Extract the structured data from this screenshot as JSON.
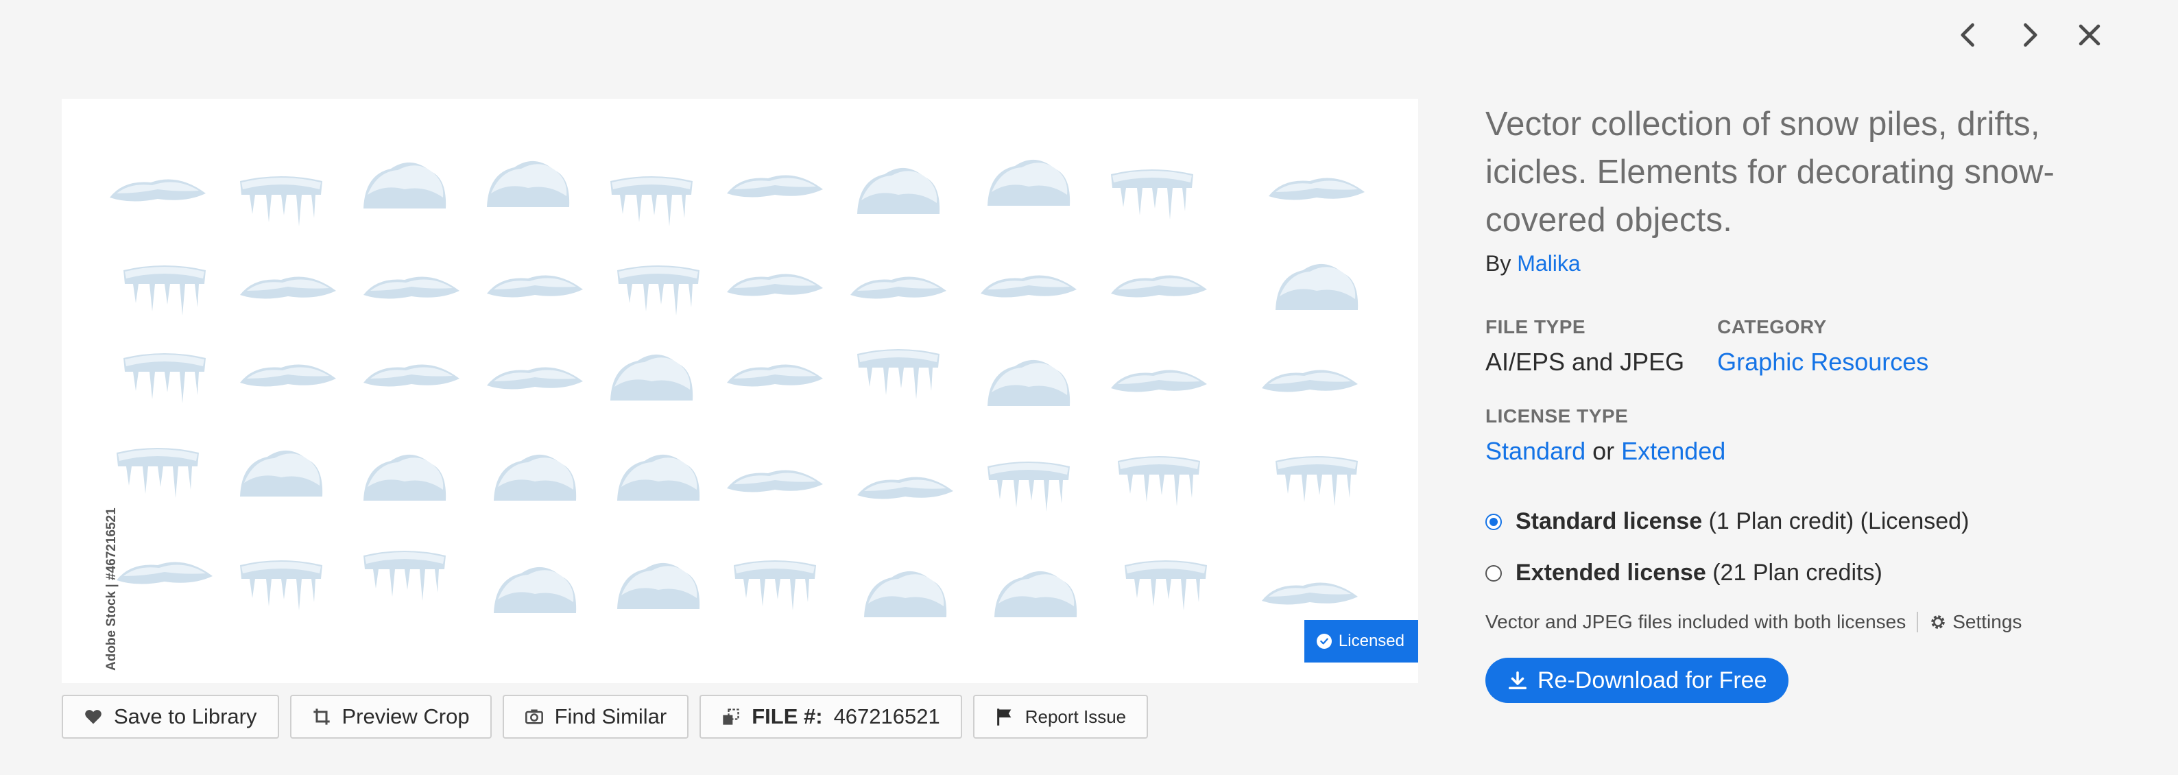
{
  "nav": {
    "prev_icon": "chevron-left-icon",
    "next_icon": "chevron-right-icon",
    "close_icon": "close-icon"
  },
  "preview": {
    "id_watermark": "Adobe Stock | #467216521",
    "badge_label": "Licensed"
  },
  "actions": {
    "save_label": "Save to Library",
    "crop_label": "Preview Crop",
    "similar_label": "Find Similar",
    "file_label": "FILE #:",
    "file_number": "467216521",
    "report_label": "Report Issue"
  },
  "info": {
    "title": "Vector collection of snow piles, drifts, icicles. Elements for decorating snow-covered objects.",
    "by_prefix": "By",
    "author": "Malika",
    "file_type_label": "FILE TYPE",
    "file_type_value": "AI/EPS and JPEG",
    "category_label": "CATEGORY",
    "category_value": "Graphic Resources",
    "license_type_label": "LICENSE TYPE",
    "license_standard": "Standard",
    "license_or": "or",
    "license_extended": "Extended",
    "standard_license_name": "Standard license",
    "standard_license_detail": "(1 Plan credit) (Licensed)",
    "extended_license_name": "Extended license",
    "extended_license_detail": "(21 Plan credits)",
    "included_text": "Vector and JPEG files included with both licenses",
    "settings_label": "Settings",
    "download_label": "Re-Download for Free"
  },
  "colors": {
    "accent": "#1473e6",
    "snow": "#c9dcea",
    "snow_light": "#e8f1f8"
  }
}
